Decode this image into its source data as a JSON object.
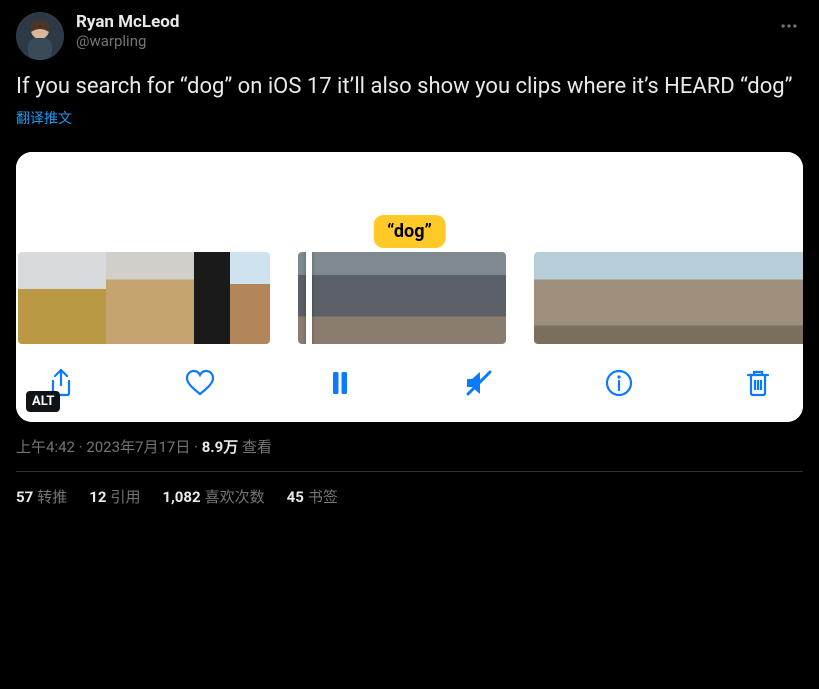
{
  "author": {
    "display_name": "Ryan McLeod",
    "handle": "@warpling"
  },
  "tweet_text": "If you search for “dog” on iOS 17 it’ll also show you clips where it’s HEARD “dog”",
  "translate_label": "翻译推文",
  "media": {
    "highlight_label": "“dog”",
    "alt_badge": "ALT",
    "toolbar": {
      "share": "share-icon",
      "like": "heart-icon",
      "pause": "pause-icon",
      "mute": "mute-icon",
      "info": "info-icon",
      "delete": "trash-icon"
    }
  },
  "meta": {
    "time": "上午4:42",
    "separator1": " · ",
    "date": "2023年7月17日",
    "separator2": " · ",
    "views_count": "8.9万",
    "views_label": " 查看"
  },
  "stats": {
    "retweets_count": "57",
    "retweets_label": "转推",
    "quotes_count": "12",
    "quotes_label": "引用",
    "likes_count": "1,082",
    "likes_label": "喜欢次数",
    "bookmarks_count": "45",
    "bookmarks_label": "书签"
  }
}
